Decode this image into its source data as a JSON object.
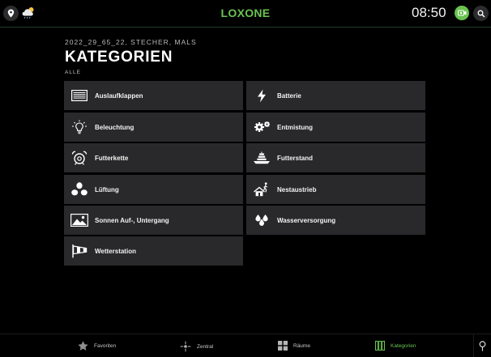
{
  "app": {
    "logo": "LOXONE",
    "time": "08:50"
  },
  "header": {
    "subtitle": "2022_29_65_22, STECHER, MALS",
    "title": "KATEGORIEN",
    "filter": "ALLE"
  },
  "categories": [
    {
      "label": "Auslaufklappen",
      "icon": "blinds-icon"
    },
    {
      "label": "Batterie",
      "icon": "lightning-icon"
    },
    {
      "label": "Beleuchtung",
      "icon": "lightbulb-icon"
    },
    {
      "label": "Entmistung",
      "icon": "gears-icon"
    },
    {
      "label": "Futterkette",
      "icon": "alarm-clock-icon"
    },
    {
      "label": "Futterstand",
      "icon": "feeder-icon"
    },
    {
      "label": "Lüftung",
      "icon": "fan-icon"
    },
    {
      "label": "Nestaustrieb",
      "icon": "nest-exit-icon"
    },
    {
      "label": "Sonnen Auf-, Untergang",
      "icon": "landscape-icon"
    },
    {
      "label": "Wasserversorgung",
      "icon": "water-drops-icon"
    },
    {
      "label": "Wetterstation",
      "icon": "windsock-icon"
    }
  ],
  "nav": {
    "favorites": "Favoriten",
    "central": "Zentral",
    "rooms": "Räume",
    "categories": "Kategorien"
  },
  "colors": {
    "accent": "#69c350",
    "tile": "#29292b",
    "background": "#000000"
  }
}
